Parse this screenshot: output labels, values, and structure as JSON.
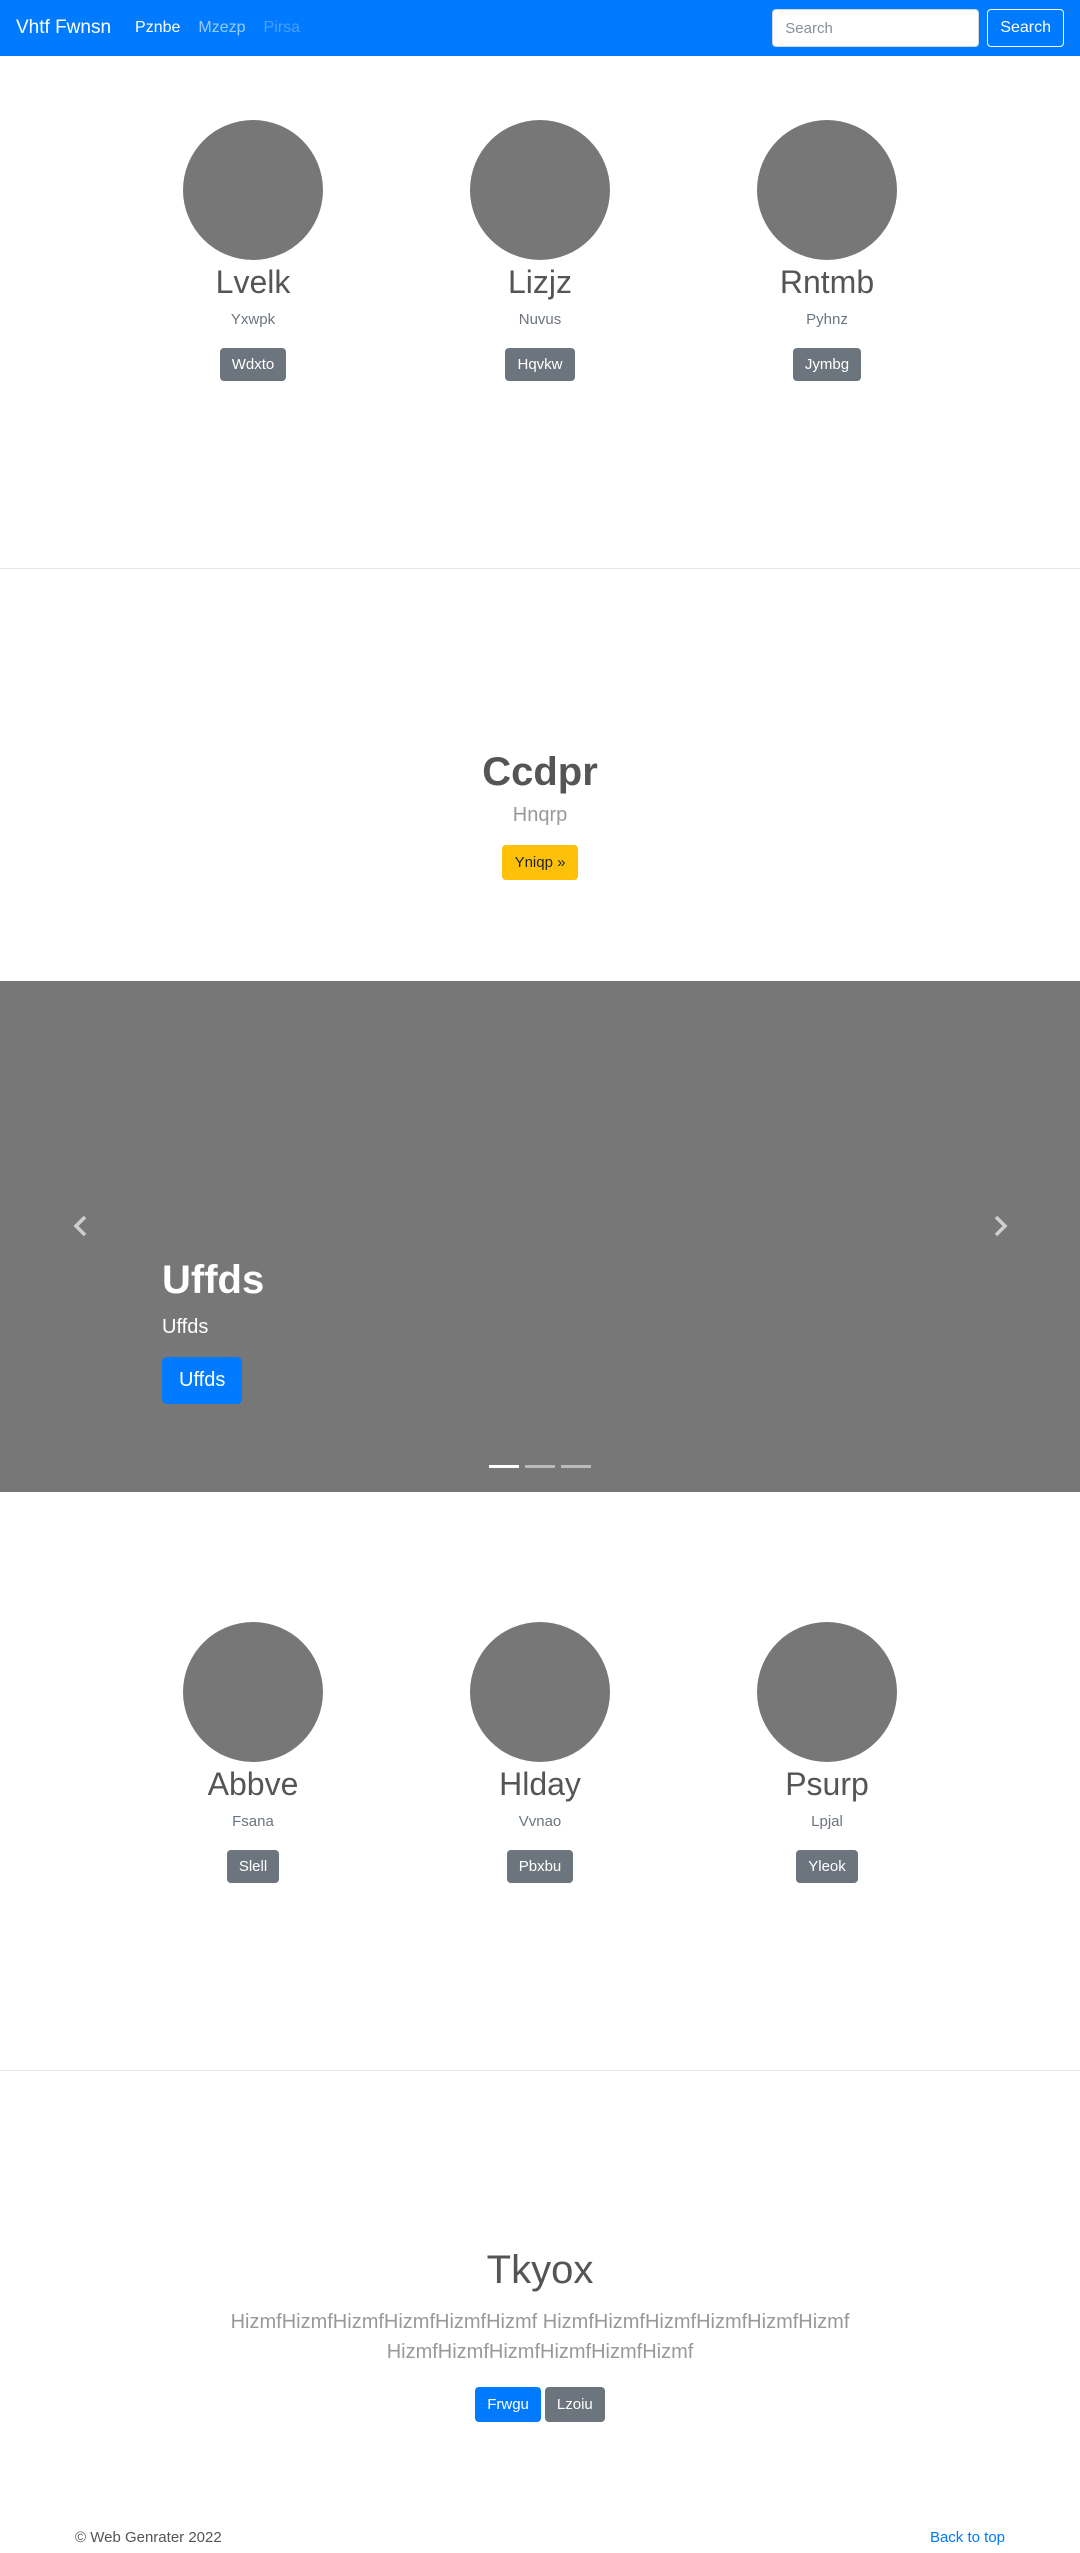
{
  "navbar": {
    "brand": "Vhtf Fwnsn",
    "links": [
      {
        "label": "Pznbe",
        "state": "active"
      },
      {
        "label": "Mzezp",
        "state": "normal"
      },
      {
        "label": "Pirsa",
        "state": "disabled"
      }
    ],
    "search_placeholder": "Search",
    "search_button": "Search"
  },
  "profiles_top": [
    {
      "name": "Lvelk",
      "subtitle": "Yxwpk",
      "button": "Wdxto"
    },
    {
      "name": "Lizjz",
      "subtitle": "Nuvus",
      "button": "Hqvkw"
    },
    {
      "name": "Rntmb",
      "subtitle": "Pyhnz",
      "button": "Jymbg"
    }
  ],
  "feature": {
    "title": "Ccdpr",
    "subtitle": "Hnqrp",
    "button": "Yniqp »"
  },
  "carousel": {
    "title": "Uffds",
    "subtitle": "Uffds",
    "button": "Uffds",
    "slides_count": 3,
    "active_slide": 1
  },
  "profiles_bottom": [
    {
      "name": "Abbve",
      "subtitle": "Fsana",
      "button": "Slell"
    },
    {
      "name": "Hlday",
      "subtitle": "Vvnao",
      "button": "Pbxbu"
    },
    {
      "name": "Psurp",
      "subtitle": "Lpjal",
      "button": "Yleok"
    }
  ],
  "jumbotron": {
    "title": "Tkyox",
    "text": "HizmfHizmfHizmfHizmfHizmfHizmf HizmfHizmfHizmfHizmfHizmfHizmf HizmfHizmfHizmfHizmfHizmfHizmf",
    "primary_button": "Frwgu",
    "secondary_button": "Lzoiu"
  },
  "footer": {
    "copyright": "© Web Genrater 2022",
    "back_to_top": "Back to top"
  },
  "colors": {
    "primary": "#007bff",
    "secondary": "#6c757d",
    "warning": "#ffc107",
    "placeholder_gray": "#777777"
  }
}
